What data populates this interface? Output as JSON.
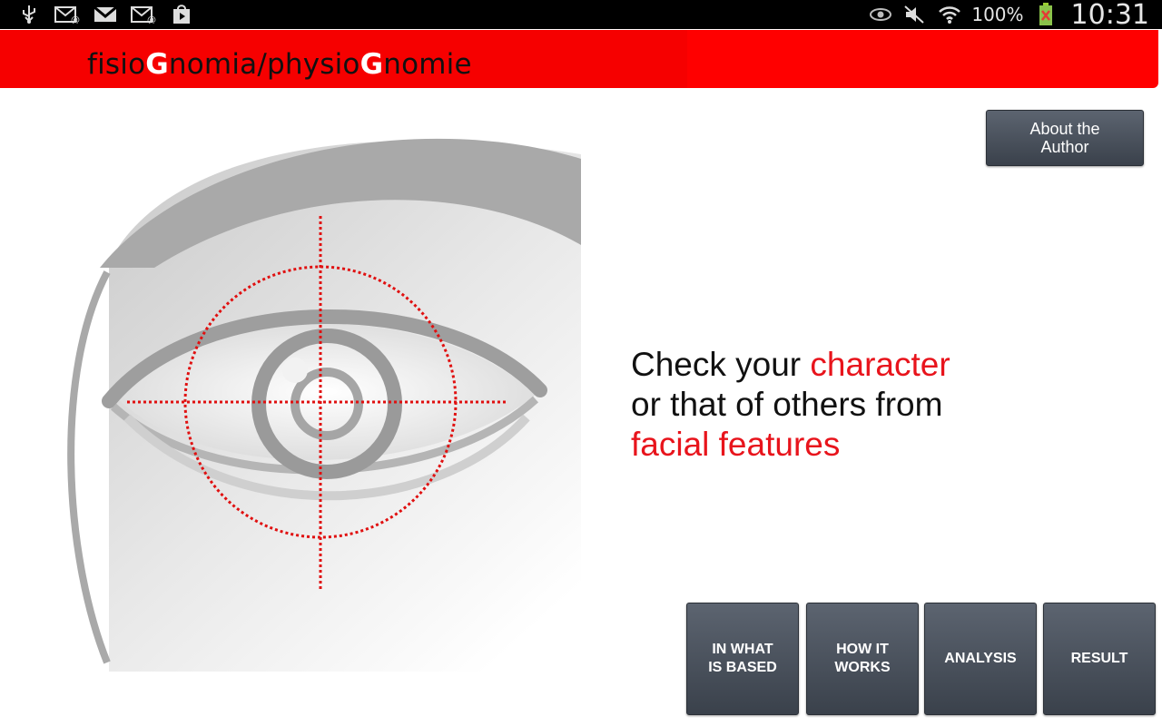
{
  "status_bar": {
    "left_icons": [
      "usb-icon",
      "email-icon",
      "gmail-icon",
      "email-icon",
      "play-store-icon"
    ],
    "right_icons": [
      "eye-icon",
      "mute-icon",
      "wifi-icon",
      "battery-icon"
    ],
    "battery_percent": "100%",
    "clock": "10:31"
  },
  "header": {
    "title_parts": [
      "fisio",
      "G",
      "nomia/physio",
      "G",
      "nomie"
    ],
    "color": "#ff0000"
  },
  "about_button": {
    "label": "About the\nAuthor"
  },
  "tagline": {
    "line1_a": "Check your ",
    "line1_b": "character",
    "line2": "or that of others from",
    "line3": "facial features",
    "accent_color": "#e8141c"
  },
  "nav_buttons": [
    {
      "label": "IN WHAT\nIS BASED"
    },
    {
      "label": "HOW IT\nWORKS"
    },
    {
      "label": "ANALYSIS"
    },
    {
      "label": "RESULT"
    }
  ]
}
